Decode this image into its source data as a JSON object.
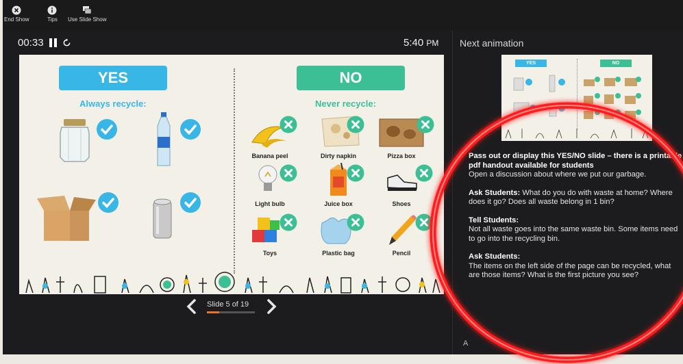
{
  "toolbar": {
    "end_show": "End Show",
    "tips": "Tips",
    "use_slide_show": "Use Slide Show"
  },
  "presenter": {
    "timer": "00:33",
    "clock_time": "5:40",
    "clock_ampm": "PM",
    "next_label": "Next animation"
  },
  "slide": {
    "yes_heading": "YES",
    "no_heading": "NO",
    "yes_sub": "Always recycle:",
    "no_sub": "Never recycle:",
    "no_items": [
      "Banana peel",
      "Dirty napkin",
      "Pizza box",
      "Light bulb",
      "Juice box",
      "Shoes",
      "Toys",
      "Plastic bag",
      "Pencil"
    ]
  },
  "preview": {
    "yes": "YES",
    "no": "NO"
  },
  "nav": {
    "label": "Slide 5 of 19",
    "current": 5,
    "total": 19
  },
  "notes": {
    "p1_bold": "Pass out or display this YES/NO slide – there is a printable pdf handout available for students",
    "p1_text": "Open a discussion about where we put our garbage.",
    "p2_bold": "Ask Students:",
    "p2_text": "What do you do with waste at home? Where does it go? Does all waste belong in 1 bin?",
    "p3_bold": "Tell Students:",
    "p3_text": "Not all waste goes into the same waste bin. Some items need to go into the recycling bin.",
    "p4_bold": "Ask Students:",
    "p4_text": "The items on the left side of the page can be recycled, what are those items? What is the first picture you see?"
  },
  "font_ctrl": "A",
  "colors": {
    "yes": "#38b6e6",
    "no": "#3dbf95",
    "highlight": "#ff1a1a",
    "progress": "#e8742a"
  }
}
